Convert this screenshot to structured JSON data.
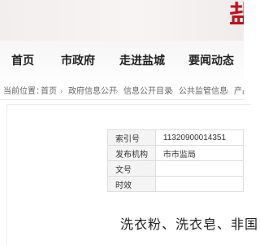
{
  "banner": {
    "brand_char": "盐"
  },
  "nav": {
    "items": [
      "首页",
      "市政府",
      "走进盐城",
      "要闻动态"
    ]
  },
  "breadcrumb": {
    "prefix": "当前位置：",
    "items": [
      "首页",
      "政府信息公开",
      "信息公开目录",
      "公共监管信息",
      "产品"
    ],
    "separator": "›"
  },
  "meta": {
    "rows": [
      {
        "label": "索引号",
        "value": "11320900014351"
      },
      {
        "label": "发布机构",
        "value": "市市监局"
      },
      {
        "label": "文号",
        "value": ""
      },
      {
        "label": "时效",
        "value": ""
      }
    ]
  },
  "document": {
    "title": "洗衣粉、洗衣皂、非国"
  }
}
